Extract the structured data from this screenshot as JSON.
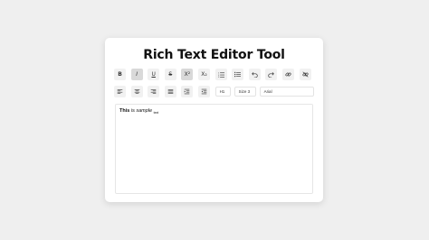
{
  "app": {
    "title": "Rich Text Editor Tool"
  },
  "toolbar_row1": [
    {
      "name": "bold-button",
      "icon": "bold-icon",
      "glyph": "B",
      "active": false
    },
    {
      "name": "italic-button",
      "icon": "italic-icon",
      "glyph": "I",
      "active": true
    },
    {
      "name": "underline-button",
      "icon": "underline-icon",
      "glyph": "U",
      "active": false
    },
    {
      "name": "strikethrough-button",
      "icon": "strikethrough-icon",
      "glyph": "S",
      "active": false
    },
    {
      "name": "superscript-button",
      "icon": "superscript-icon",
      "glyph": "X²",
      "active": true
    },
    {
      "name": "subscript-button",
      "icon": "subscript-icon",
      "glyph": "X₂",
      "active": false
    },
    {
      "name": "ordered-list-button",
      "icon": "ordered-list-icon",
      "glyph": "",
      "active": false
    },
    {
      "name": "unordered-list-button",
      "icon": "unordered-list-icon",
      "glyph": "",
      "active": false
    },
    {
      "name": "undo-button",
      "icon": "undo-icon",
      "glyph": "",
      "active": false
    },
    {
      "name": "redo-button",
      "icon": "redo-icon",
      "glyph": "",
      "active": false
    },
    {
      "name": "link-button",
      "icon": "link-icon",
      "glyph": "",
      "active": false
    },
    {
      "name": "unlink-button",
      "icon": "unlink-icon",
      "glyph": "",
      "active": false
    }
  ],
  "toolbar_row2": {
    "align_buttons": [
      {
        "name": "align-left-button",
        "icon": "align-left-icon"
      },
      {
        "name": "align-center-button",
        "icon": "align-center-icon"
      },
      {
        "name": "align-right-button",
        "icon": "align-right-icon"
      },
      {
        "name": "align-justify-button",
        "icon": "align-justify-icon"
      },
      {
        "name": "indent-button",
        "icon": "indent-icon"
      },
      {
        "name": "outdent-button",
        "icon": "outdent-icon"
      }
    ],
    "heading_select": "H1",
    "size_select": "Size 3",
    "font_select": "Arial"
  },
  "editor": {
    "bold_text": "This",
    "plain_text": " is ",
    "italic_text": "sample",
    "sub_text": "text"
  },
  "colors": {
    "background": "#efefef",
    "card": "#ffffff",
    "button": "#f1f1f1",
    "button_active": "#d9d9d9"
  }
}
